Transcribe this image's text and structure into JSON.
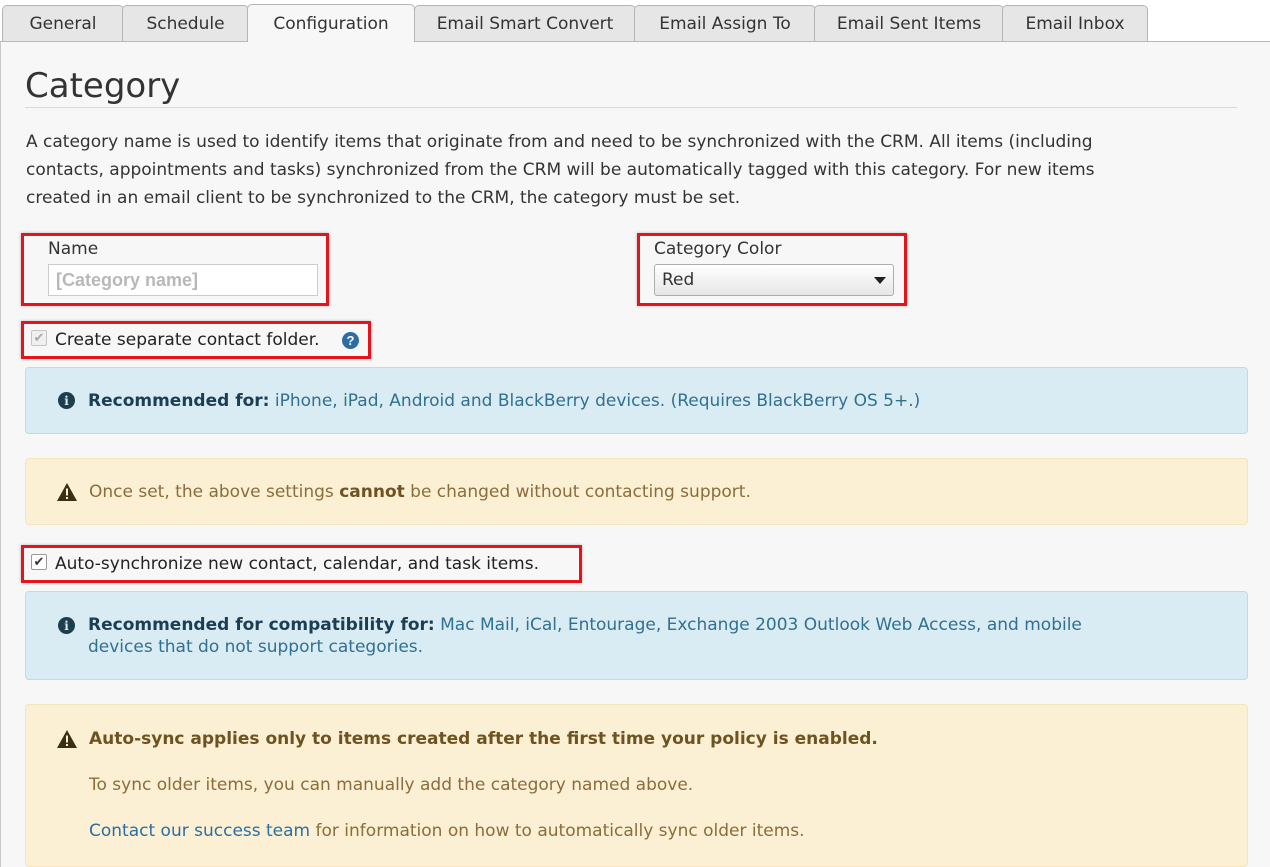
{
  "tabs": [
    {
      "label": "General"
    },
    {
      "label": "Schedule"
    },
    {
      "label": "Configuration"
    },
    {
      "label": "Email Smart Convert"
    },
    {
      "label": "Email Assign To"
    },
    {
      "label": "Email Sent Items"
    },
    {
      "label": "Email Inbox"
    }
  ],
  "active_tab": "Configuration",
  "section": {
    "title": "Category",
    "description_line1": "A category name is used to identify items that originate from and need to be synchronized with the CRM. All items (including",
    "description_line2": "contacts, appointments and tasks) synchronized from the CRM will be automatically tagged with this category. For new items",
    "description_line3": "created in an email client to be synchronized to the CRM, the category must be set."
  },
  "name_field": {
    "label": "Name",
    "placeholder": "[Category name]",
    "value": ""
  },
  "color_field": {
    "label": "Category Color",
    "value": "Red"
  },
  "separate_folder": {
    "label": "Create separate contact folder.",
    "checked": true,
    "disabled": true,
    "help": "?"
  },
  "info_devices": {
    "bold": "Recommended for:",
    "text": " iPhone, iPad, Android and BlackBerry devices. (Requires BlackBerry OS 5+.)"
  },
  "warn_settings": {
    "before": "Once set, the above settings ",
    "bold": "cannot",
    "after": " be changed without contacting support."
  },
  "auto_sync": {
    "label": "Auto-synchronize new contact, calendar, and task items.",
    "checked": true
  },
  "info_compat": {
    "bold": "Recommended for compatibility for:",
    "text_line1": " Mac Mail, iCal, Entourage, Exchange 2003 Outlook Web Access, and mobile",
    "text_line2": "devices that do not support categories."
  },
  "warn_autosync": {
    "heading": "Auto-sync applies only to items created after the first time your policy is enabled.",
    "line2": "To sync older items, you can manually add the category named above.",
    "link": "Contact our success team",
    "line3_rest": " for information on how to automatically sync older items."
  },
  "colors": {
    "highlight": "#e3141b",
    "info_bg": "#d9ecf3",
    "warn_bg": "#fbf0d3",
    "link": "#2a6ea5"
  }
}
